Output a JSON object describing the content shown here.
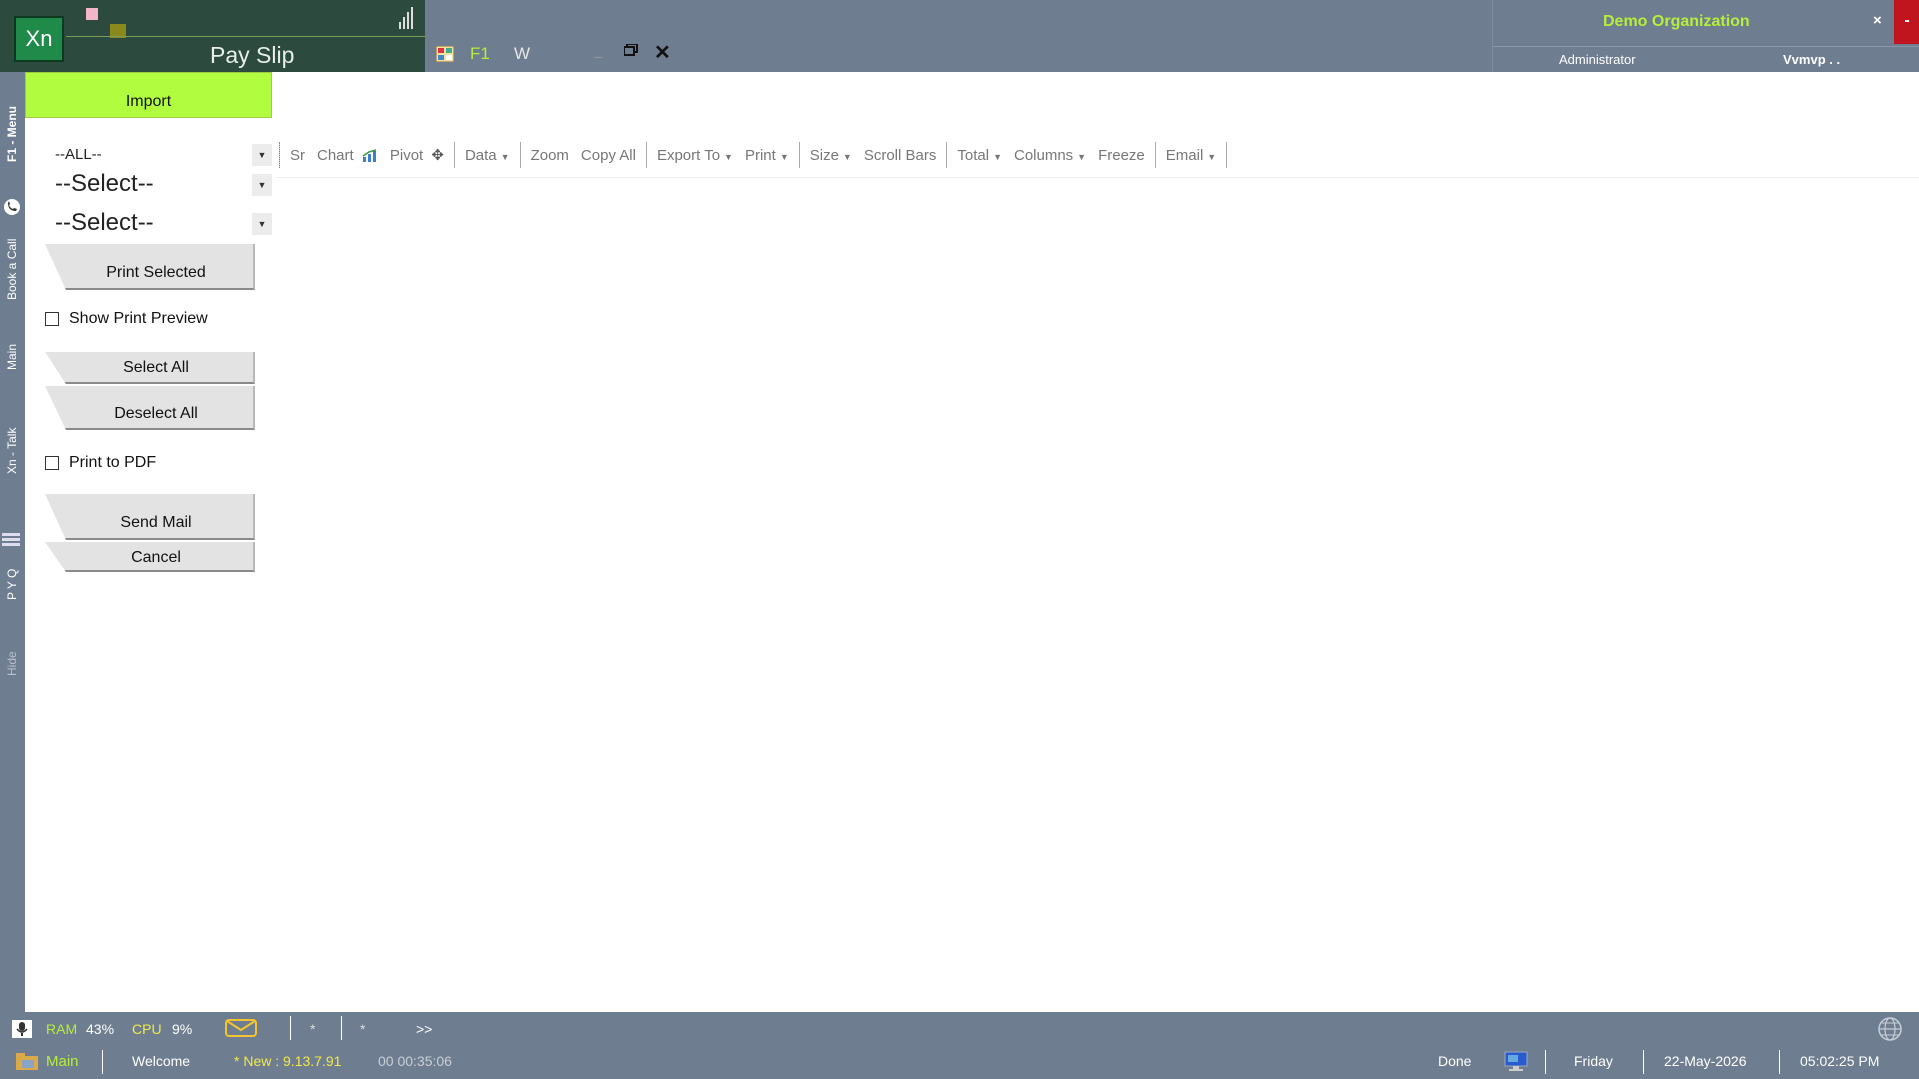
{
  "window": {
    "app_logo": "Xn",
    "title": "Pay Slip",
    "f1_label": "F1",
    "w_label": "W",
    "minimize_label": "_",
    "close_label": "✕"
  },
  "org": {
    "name": "Demo Organization",
    "close_label": "×",
    "minus_label": "-",
    "role": "Administrator",
    "user": "Vvmvp . ."
  },
  "side_tabs": {
    "menu": "F1 - Menu",
    "book_call": "Book a Call",
    "main": "Main",
    "xn_talk": "Xn - Talk",
    "pyq": "P Y Q",
    "hide": "Hide"
  },
  "left_panel": {
    "import_label": "Import",
    "dropdown_all": "--ALL--",
    "dropdown_select_1": "--Select--",
    "dropdown_select_2": "--Select--",
    "print_selected_label": "Print Selected",
    "show_print_preview_label": "Show Print Preview",
    "select_all_label": "Select All",
    "deselect_all_label": "Deselect All",
    "print_to_pdf_label": "Print to PDF",
    "send_mail_label": "Send Mail",
    "cancel_label": "Cancel"
  },
  "toolbar": {
    "sr": "Sr",
    "chart": "Chart",
    "pivot": "Pivot",
    "data": "Data",
    "zoom": "Zoom",
    "copy_all": "Copy All",
    "export_to": "Export To",
    "print": "Print",
    "size": "Size",
    "scroll_bars": "Scroll Bars",
    "total": "Total",
    "columns": "Columns",
    "freeze": "Freeze",
    "email": "Email"
  },
  "status": {
    "ram_label": "RAM",
    "ram_value": "43%",
    "cpu_label": "CPU",
    "cpu_value": "9%",
    "star1": "*",
    "star2": "*",
    "more": ">>",
    "main": "Main",
    "welcome": "Welcome",
    "new_version": "* New : 9.13.7.91",
    "timer": "00 00:35:06",
    "done": "Done",
    "day": "Friday",
    "date": "22-May-2026",
    "time": "05:02:25 PM"
  },
  "colors": {
    "accent_green": "#b6ef3b",
    "import_bg": "#b1fc3e",
    "frame": "#6e7e90",
    "title_bg": "#2c4a3e"
  }
}
